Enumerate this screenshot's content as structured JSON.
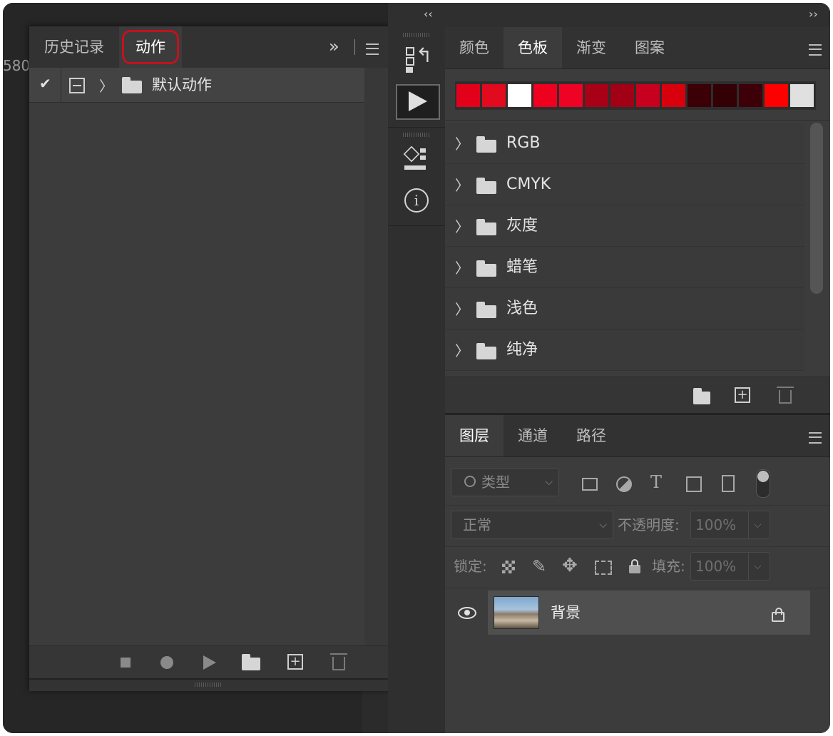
{
  "actions_panel": {
    "tabs": [
      {
        "label": "历史记录",
        "active": false
      },
      {
        "label": "动作",
        "active": true
      }
    ],
    "expand_glyph": "»",
    "default_set": {
      "label": "默认动作",
      "checked": true
    },
    "footer_icons": [
      "stop-icon",
      "record-icon",
      "play-icon",
      "folder-icon",
      "new-action-icon",
      "trash-icon"
    ]
  },
  "ruler": {
    "number": "580"
  },
  "swatches_panel": {
    "tabs": [
      {
        "label": "颜色",
        "active": false
      },
      {
        "label": "色板",
        "active": true
      },
      {
        "label": "渐变",
        "active": false
      },
      {
        "label": "图案",
        "active": false
      }
    ],
    "recent_colors": [
      "#e3001b",
      "#e20a1e",
      "#ffffff",
      "#f0001f",
      "#ef0324",
      "#a80016",
      "#a20014",
      "#c7001f",
      "#d8000c",
      "#3a0006",
      "#320005",
      "#3d0008",
      "#ff0000",
      "#e0e0e0"
    ],
    "groups": [
      "RGB",
      "CMYK",
      "灰度",
      "蜡笔",
      "浅色",
      "纯净"
    ]
  },
  "layers_panel": {
    "tabs": [
      {
        "label": "图层",
        "active": true
      },
      {
        "label": "通道",
        "active": false
      },
      {
        "label": "路径",
        "active": false
      }
    ],
    "filter_placeholder": "类型",
    "blend_mode": "正常",
    "opacity_label": "不透明度:",
    "opacity_value": "100%",
    "lock_label": "锁定:",
    "fill_label": "填充:",
    "fill_value": "100%",
    "layers": [
      {
        "name": "背景",
        "visible": true,
        "locked": true
      }
    ]
  },
  "colors": {
    "accent_highlight": "#c1121f"
  }
}
